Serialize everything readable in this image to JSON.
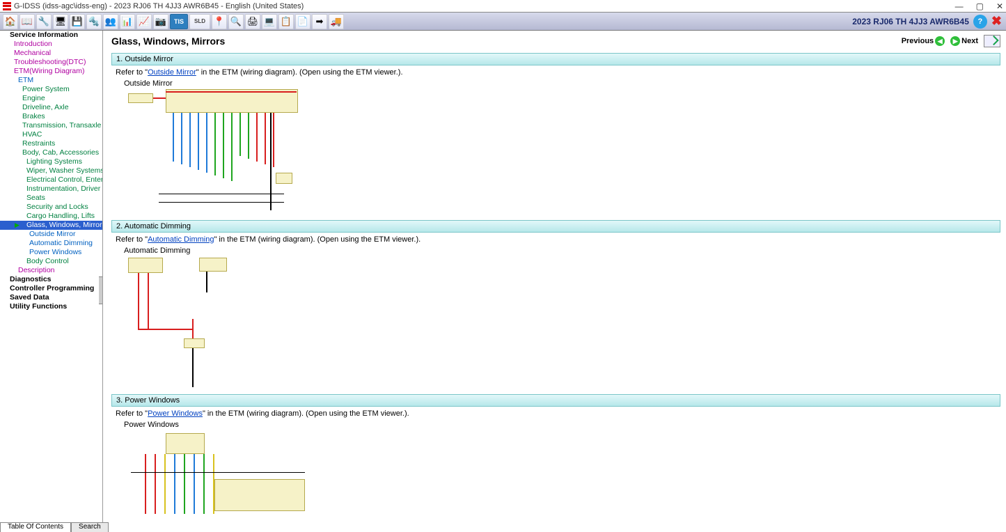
{
  "window_title": "G-IDSS (idss-agc\\idss-eng) - 2023 RJ06 TH 4JJ3 AWR6B45 - English (United States)",
  "toolbar_vehicle_right": "2023 RJ06 TH 4JJ3 AWR6B45",
  "toolbar_icons": [
    "home-icon",
    "book-icon",
    "engine-diag-icon",
    "programming-icon",
    "save-icon",
    "wrench-icon",
    "people-icon",
    "chart-icon",
    "scope-icon",
    "capture-icon",
    "tis-icon",
    "sld-icon",
    "pin-icon",
    "search-icon",
    "print-icon",
    "laptop-icon",
    "clipboard-list-icon",
    "clipboard-icon",
    "arrow-right-icon",
    "truck-icon"
  ],
  "toolbar_glyphs": [
    "🏠",
    "📖",
    "🔧",
    "🖥",
    "💾",
    "🔩",
    "👥",
    "📊",
    "📈",
    "📷",
    "TIS",
    "SLD",
    "📍",
    "🔍",
    "🖨",
    "💻",
    "📋",
    "📄",
    "➡",
    "🚚"
  ],
  "tree": [
    {
      "label": "Service Information",
      "cls": "lvl0"
    },
    {
      "label": "Introduction",
      "cls": "lvl1"
    },
    {
      "label": "Mechanical",
      "cls": "lvl1"
    },
    {
      "label": "Troubleshooting(DTC)",
      "cls": "lvl1"
    },
    {
      "label": "ETM(Wiring Diagram)",
      "cls": "lvl1"
    },
    {
      "label": "ETM",
      "cls": "lvl2"
    },
    {
      "label": "Power System",
      "cls": "lvl3"
    },
    {
      "label": "Engine",
      "cls": "lvl3"
    },
    {
      "label": "Driveline, Axle",
      "cls": "lvl3"
    },
    {
      "label": "Brakes",
      "cls": "lvl3"
    },
    {
      "label": "Transmission, Transaxle",
      "cls": "lvl3"
    },
    {
      "label": "HVAC",
      "cls": "lvl3"
    },
    {
      "label": "Restraints",
      "cls": "lvl3"
    },
    {
      "label": "Body, Cab, Accessories",
      "cls": "lvl3"
    },
    {
      "label": "Lighting Systems",
      "cls": "lvl4",
      "green": true
    },
    {
      "label": "Wiper, Washer Systems",
      "cls": "lvl4",
      "green": true
    },
    {
      "label": "Electrical Control, Entertainment",
      "cls": "lvl4",
      "green": true
    },
    {
      "label": "Instrumentation, Driver Info",
      "cls": "lvl4",
      "green": true
    },
    {
      "label": "Seats",
      "cls": "lvl4",
      "green": true
    },
    {
      "label": "Security and Locks",
      "cls": "lvl4",
      "green": true
    },
    {
      "label": "Cargo Handling, Lifts",
      "cls": "lvl4",
      "green": true
    },
    {
      "label": "Glass, Windows, Mirrors",
      "cls": "lvl4",
      "green": true,
      "selected": true,
      "arrow": true
    },
    {
      "label": "Outside Mirror",
      "cls": "lvl4",
      "indent_extra": true
    },
    {
      "label": "Automatic Dimming",
      "cls": "lvl4",
      "indent_extra": true
    },
    {
      "label": "Power Windows",
      "cls": "lvl4",
      "indent_extra": true
    },
    {
      "label": "Body Control",
      "cls": "lvl4",
      "green": true
    },
    {
      "label": "Description",
      "cls": "lvl2",
      "pink": true
    },
    {
      "label": "Diagnostics",
      "cls": "lvl0b"
    },
    {
      "label": "Controller Programming",
      "cls": "lvl0b"
    },
    {
      "label": "Saved Data",
      "cls": "lvl0b"
    },
    {
      "label": "Utility Functions",
      "cls": "lvl0b"
    }
  ],
  "page": {
    "title": "Glass, Windows, Mirrors",
    "prev": "Previous",
    "next": "Next",
    "sections": [
      {
        "num": "1.",
        "heading": "Outside Mirror",
        "refer_pre": "Refer to \"",
        "link": "Outside Mirror",
        "refer_post": "\" in the ETM (wiring diagram). (Open using the ETM viewer.).",
        "caption": "Outside Mirror"
      },
      {
        "num": "2.",
        "heading": "Automatic Dimming",
        "refer_pre": "Refer to \"",
        "link": "Automatic Dimming",
        "refer_post": "\" in the ETM (wiring diagram). (Open using the ETM viewer.).",
        "caption": "Automatic Dimming"
      },
      {
        "num": "3.",
        "heading": "Power Windows",
        "refer_pre": "Refer to \"",
        "link": "Power Windows",
        "refer_post": "\" in the ETM (wiring diagram). (Open using the ETM viewer.).",
        "caption": "Power Windows"
      }
    ]
  },
  "bottom_tabs": {
    "toc": "Table Of Contents",
    "search": "Search"
  }
}
